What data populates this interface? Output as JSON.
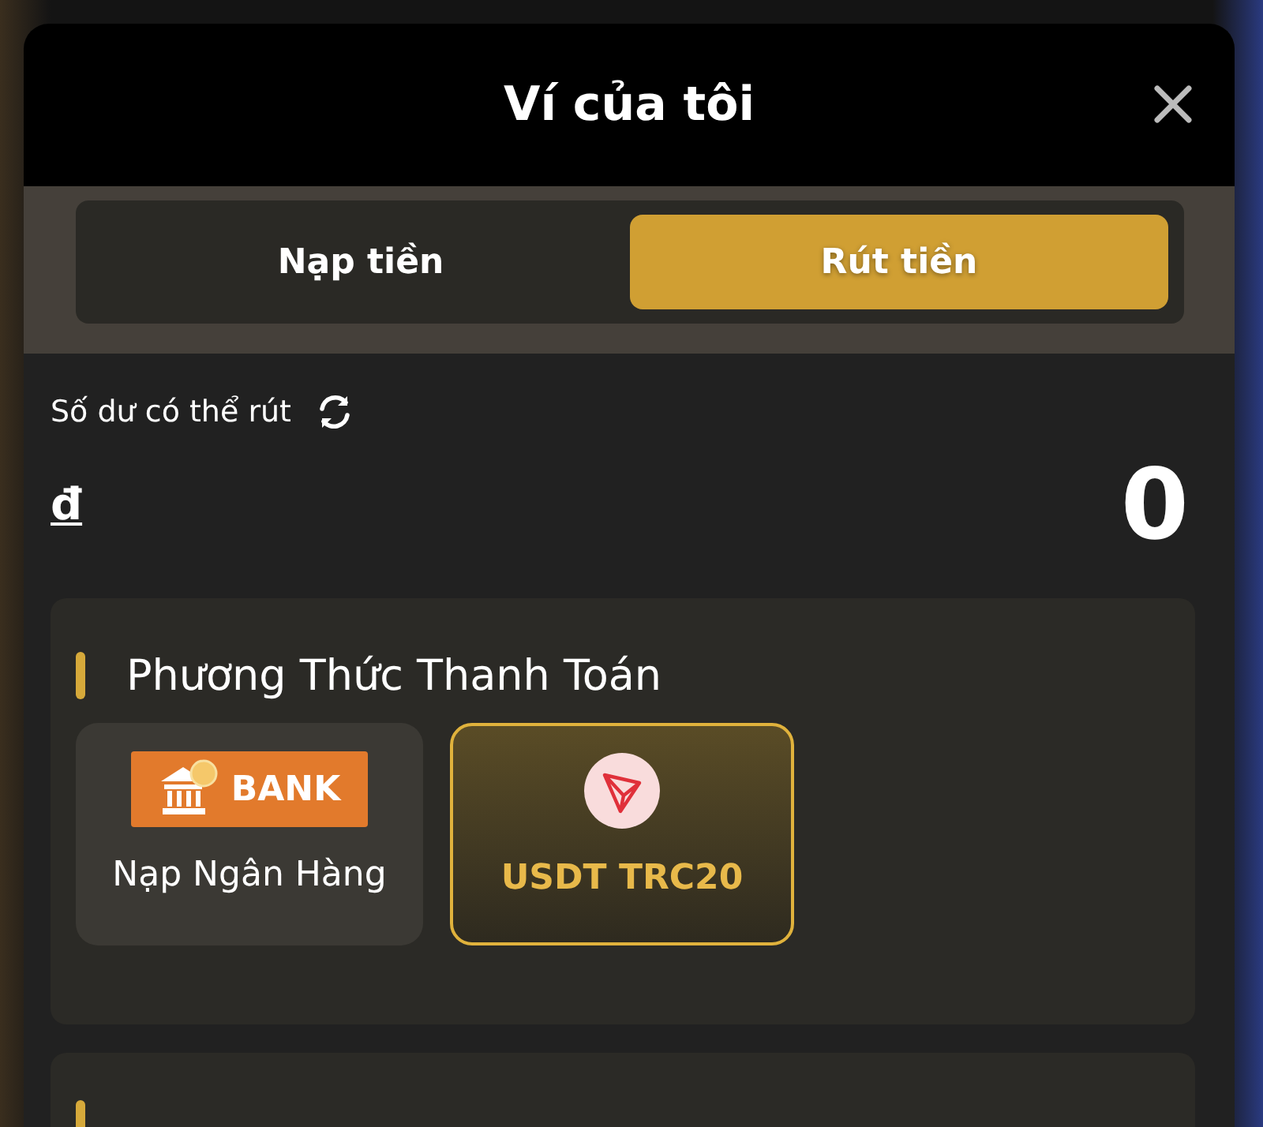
{
  "window": {
    "title": "Ví của tôi"
  },
  "tabs": [
    {
      "label": "Nạp tiền",
      "selected": false
    },
    {
      "label": "Rút tiền",
      "selected": true
    }
  ],
  "balance": {
    "label": "Số dư có thể rút",
    "currency": "đ",
    "amount": "0"
  },
  "payment_methods": {
    "title": "Phương Thức Thanh Toán",
    "items": [
      {
        "kind": "bank",
        "logo_text": "BANK",
        "label": "Nạp Ngân Hàng",
        "selected": false
      },
      {
        "kind": "tron",
        "label": "USDT TRC20",
        "selected": true
      }
    ]
  }
}
